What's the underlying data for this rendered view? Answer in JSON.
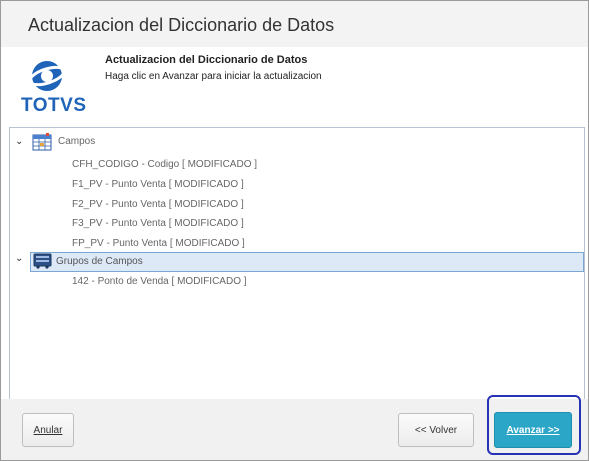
{
  "window": {
    "title": "Actualizacion del Diccionario de Datos"
  },
  "header": {
    "logo_text": "TOTVS",
    "title": "Actualizacion del Diccionario de Datos",
    "subtitle": "Haga clic en Avanzar para iniciar la actualizacion"
  },
  "tree": {
    "groups": [
      {
        "label": "Campos",
        "expanded": true,
        "icon": "table-icon",
        "items": [
          "CFH_CODIGO - Codigo  [ MODIFICADO ]",
          "F1_PV - Punto Venta  [ MODIFICADO ]",
          "F2_PV - Punto Venta  [ MODIFICADO ]",
          "F3_PV - Punto Venta  [ MODIFICADO ]",
          "FP_PV - Punto Venta  [ MODIFICADO ]"
        ]
      },
      {
        "label": "Grupos de Campos",
        "expanded": true,
        "selected": true,
        "icon": "field-group-icon",
        "items": [
          "142 - Ponto de Venda  [ MODIFICADO ]"
        ]
      }
    ]
  },
  "footer": {
    "cancel_label": "Anular",
    "back_label": "<< Volver",
    "next_label": "Avanzar >>"
  },
  "colors": {
    "primary_button": "#2ba6c7",
    "highlight_border": "#2733b4",
    "logo_blue": "#1f64b8"
  }
}
